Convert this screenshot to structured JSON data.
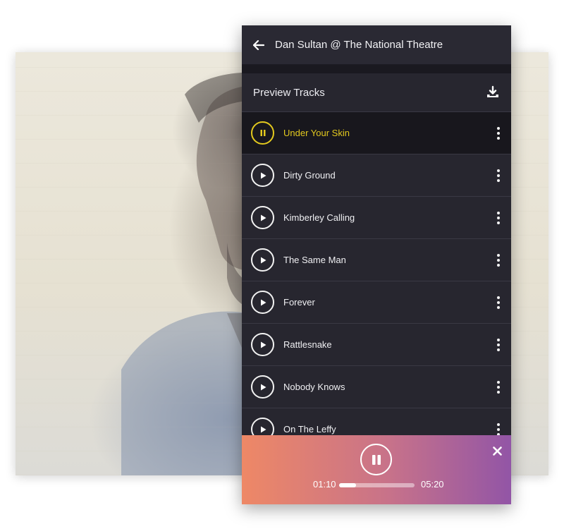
{
  "header": {
    "title": "Dan Sultan @ The National Theatre"
  },
  "section": {
    "title": "Preview Tracks"
  },
  "tracks": [
    {
      "title": "Under Your Skin",
      "state": "playing"
    },
    {
      "title": "Dirty Ground",
      "state": "stopped"
    },
    {
      "title": "Kimberley Calling",
      "state": "stopped"
    },
    {
      "title": "The Same Man",
      "state": "stopped"
    },
    {
      "title": "Forever",
      "state": "stopped"
    },
    {
      "title": "Rattlesnake",
      "state": "stopped"
    },
    {
      "title": "Nobody Knows",
      "state": "stopped"
    },
    {
      "title": "On The Leffy",
      "state": "stopped"
    }
  ],
  "player": {
    "current_time": "01:10",
    "total_time": "05:20",
    "progress": 0.22
  },
  "colors": {
    "panel_bg": "#27262f",
    "active_accent": "#e3c91e",
    "player_gradient_start": "#ee8866",
    "player_gradient_end": "#9255a6"
  },
  "icons": {
    "back": "arrow-left-icon",
    "download": "download-icon",
    "play": "play-icon",
    "pause": "pause-icon",
    "more": "more-vertical-icon",
    "close": "close-icon"
  }
}
